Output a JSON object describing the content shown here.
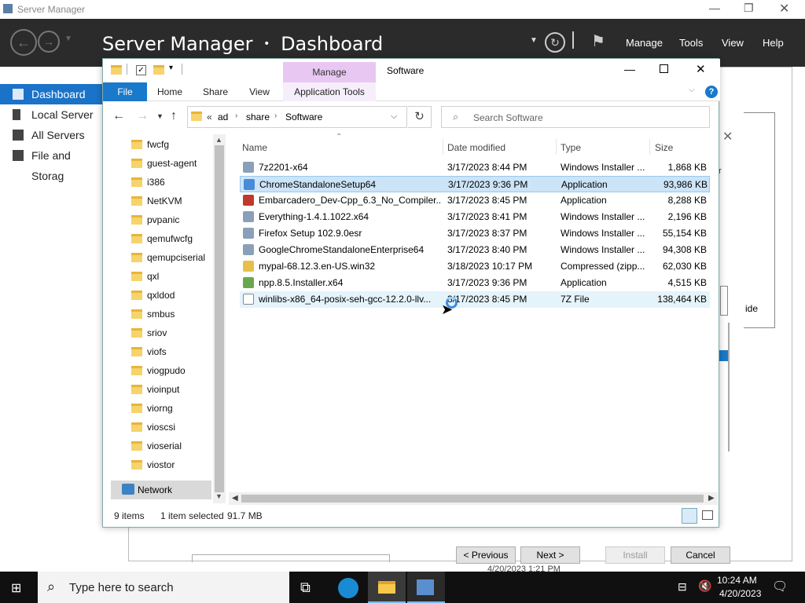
{
  "server_manager": {
    "title": "Server Manager",
    "header": "Server Manager",
    "header_sep": "•",
    "header_page": "Dashboard",
    "menu": [
      "Manage",
      "Tools",
      "View",
      "Help"
    ],
    "nav": [
      "Dashboard",
      "Local Server",
      "All Servers",
      "File and Storag"
    ]
  },
  "explorer": {
    "ribbon": {
      "manage": "Manage",
      "window_title": "Software",
      "tabs": [
        "File",
        "Home",
        "Share",
        "View",
        "Application Tools"
      ]
    },
    "address": {
      "chev": "«",
      "parts": [
        "ad",
        "share",
        "Software"
      ]
    },
    "search_placeholder": "Search Software",
    "tree": [
      "fwcfg",
      "guest-agent",
      "i386",
      "NetKVM",
      "pvpanic",
      "qemufwcfg",
      "qemupciserial",
      "qxl",
      "qxldod",
      "smbus",
      "sriov",
      "viofs",
      "viogpudo",
      "vioinput",
      "viorng",
      "vioscsi",
      "vioserial",
      "viostor"
    ],
    "tree_network": "Network",
    "columns": [
      "Name",
      "Date modified",
      "Type",
      "Size"
    ],
    "files": [
      {
        "name": "7z2201-x64",
        "date": "3/17/2023 8:44 PM",
        "type": "Windows Installer ...",
        "size": "1,868 KB",
        "icon": "msi-icon"
      },
      {
        "name": "ChromeStandaloneSetup64",
        "date": "3/17/2023 9:36 PM",
        "type": "Application",
        "size": "93,986 KB",
        "icon": "chrome-icon"
      },
      {
        "name": "Embarcadero_Dev-Cpp_6.3_No_Compiler...",
        "date": "3/17/2023 8:45 PM",
        "type": "Application",
        "size": "8,288 KB",
        "icon": "devcpp-icon"
      },
      {
        "name": "Everything-1.4.1.1022.x64",
        "date": "3/17/2023 8:41 PM",
        "type": "Windows Installer ...",
        "size": "2,196 KB",
        "icon": "msi-icon"
      },
      {
        "name": "Firefox Setup 102.9.0esr",
        "date": "3/17/2023 8:37 PM",
        "type": "Windows Installer ...",
        "size": "55,154 KB",
        "icon": "msi-icon"
      },
      {
        "name": "GoogleChromeStandaloneEnterprise64",
        "date": "3/17/2023 8:40 PM",
        "type": "Windows Installer ...",
        "size": "94,308 KB",
        "icon": "msi-icon"
      },
      {
        "name": "mypal-68.12.3.en-US.win32",
        "date": "3/18/2023 10:17 PM",
        "type": "Compressed (zipp...",
        "size": "62,030 KB",
        "icon": "zip-icon"
      },
      {
        "name": "npp.8.5.Installer.x64",
        "date": "3/17/2023 9:36 PM",
        "type": "Application",
        "size": "4,515 KB",
        "icon": "npp-icon"
      },
      {
        "name": "winlibs-x86_64-posix-seh-gcc-12.2.0-llv...",
        "date": "3/17/2023 8:45 PM",
        "type": "7Z File",
        "size": "138,464 KB",
        "icon": "file-icon"
      }
    ],
    "status": {
      "count": "9 items",
      "selected": "1 item selected",
      "size": "91.7 MB"
    }
  },
  "wizard": {
    "buttons": [
      "< Previous",
      "Next >",
      "Install",
      "Cancel"
    ],
    "partial_right": "ide",
    "partial_r": "r",
    "footer_date": "4/20/2023 1:21 PM"
  },
  "taskbar": {
    "search_placeholder": "Type here to search",
    "time": "10:24 AM",
    "date": "4/20/2023"
  },
  "colors": {
    "accent": "#1979ca",
    "manage_tab": "#e8c8f3",
    "selection": "#cce4f7"
  }
}
